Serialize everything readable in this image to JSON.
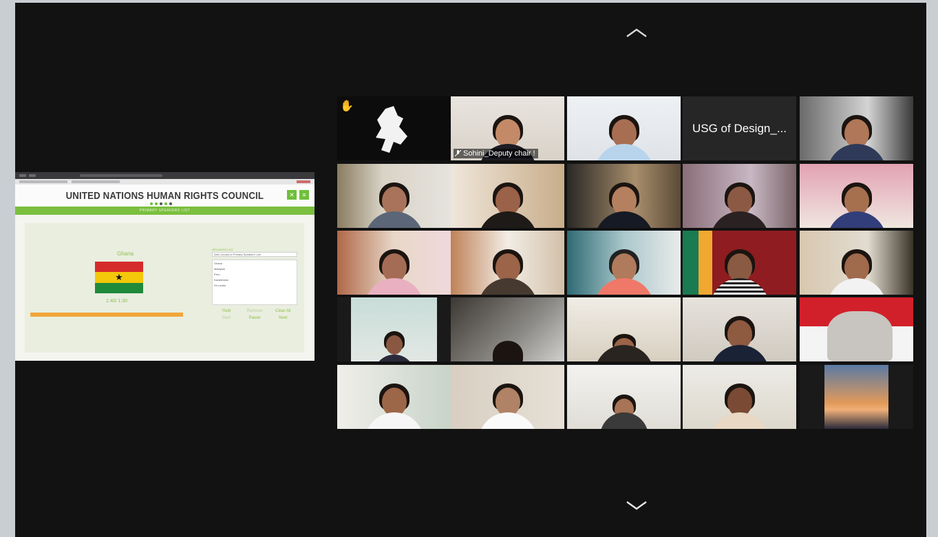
{
  "navigation": {
    "up_icon": "chevron-up-icon",
    "down_icon": "chevron-down-icon"
  },
  "shared_screen": {
    "header_title": "UNITED NATIONS HUMAN RIGHTS COUNCIL",
    "section_title": "PRIMARY SPEAKERS LIST",
    "country": "Ghana",
    "timer": "1:40/ 1:30",
    "progress_fraction": 1.0,
    "side_label": "SPEAKERS LIST",
    "speaker_select": "Add Country to Primary Speakers' List",
    "list_items": [
      "Ghana",
      "Malaysia",
      "Peru",
      "Kazakhstan",
      "Sri Lanka"
    ],
    "buttons": [
      {
        "label": "Yield",
        "faded": false
      },
      {
        "label": "Remove",
        "faded": true
      },
      {
        "label": "Clear All",
        "faded": false
      },
      {
        "label": "Start",
        "faded": true
      },
      {
        "label": "Pause",
        "faded": false
      },
      {
        "label": "Next",
        "faded": false
      }
    ]
  },
  "participants": [
    {
      "id": "p1",
      "kind": "silhouette",
      "hand_raised": true
    },
    {
      "id": "p2",
      "kind": "video",
      "name": "Sohini_Deputy chair !",
      "active": true
    },
    {
      "id": "p3",
      "kind": "video"
    },
    {
      "id": "p4",
      "kind": "name",
      "name": "USG of Design_..."
    },
    {
      "id": "p5",
      "kind": "video"
    }
  ],
  "colors": {
    "background": "#121212",
    "active_outline": "#c8e06c",
    "accent_green": "#7bbf3f"
  }
}
